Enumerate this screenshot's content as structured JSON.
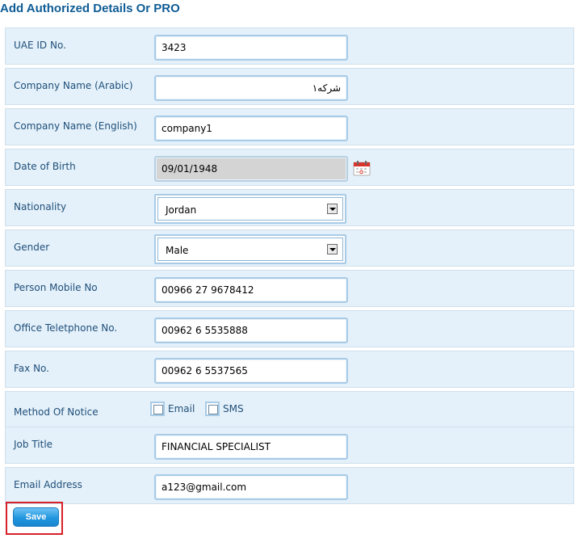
{
  "title": "Add Authorized Details Or PRO",
  "fields": {
    "uae_id": {
      "label": "UAE ID No.",
      "value": "3423"
    },
    "company_ar": {
      "label": "Company Name (Arabic)",
      "value": "شركه١"
    },
    "company_en": {
      "label": "Company Name (English)",
      "value": "company1"
    },
    "dob": {
      "label": "Date of Birth",
      "value": "09/01/1948"
    },
    "nationality": {
      "label": "Nationality",
      "value": "Jordan"
    },
    "gender": {
      "label": "Gender",
      "value": "Male"
    },
    "mobile": {
      "label": "Person Mobile No",
      "value": "00966 27 9678412"
    },
    "office_phone": {
      "label": "Office Teletphone No.",
      "value": "00962 6 5535888"
    },
    "fax": {
      "label": "Fax No.",
      "value": "00962 6 5537565"
    },
    "notice": {
      "label": "Method Of Notice",
      "email_label": "Email",
      "sms_label": "SMS",
      "email_checked": false,
      "sms_checked": false
    },
    "job_title": {
      "label": "Job Title",
      "value": "FINANCIAL SPECIALIST"
    },
    "email": {
      "label": "Email Address",
      "value": "a123@gmail.com"
    }
  },
  "save_label": "Save",
  "colors": {
    "title": "#0f5c95",
    "row_bg": "#e4f1fa",
    "highlight": "#d8202a",
    "button": "#2196df"
  },
  "icons": {
    "calendar": "calendar-icon",
    "dropdown": "chevron-down-icon"
  }
}
